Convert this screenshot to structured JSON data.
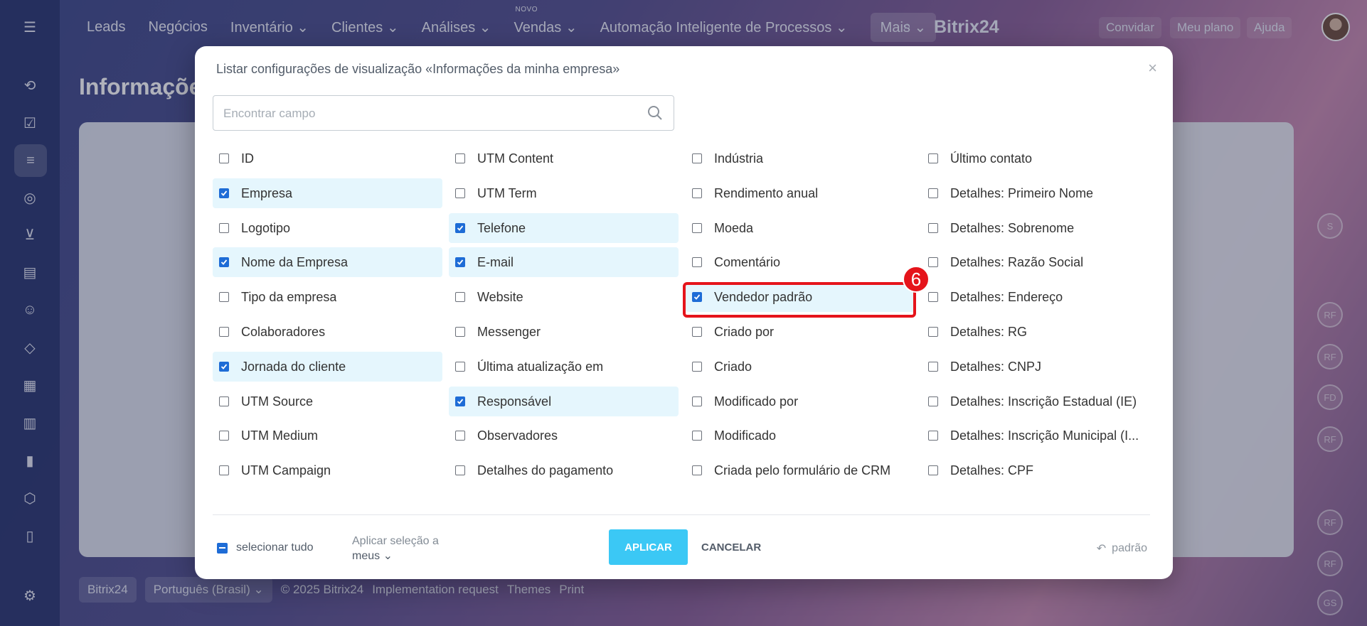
{
  "topbar": {
    "nav": [
      "Leads",
      "Negócios",
      "Inventário ⌄",
      "Clientes ⌄",
      "Análises ⌄",
      "Vendas ⌄",
      "Automação Inteligente de Processos ⌄",
      "Mais ⌄"
    ],
    "new_badge": "NOVO",
    "brand": "Bitrix24",
    "invite": "Convidar",
    "plan": "Meu plano",
    "help": "Ajuda"
  },
  "background": {
    "page_title": "Informações",
    "footer": [
      "Bitrix24",
      "Português (Brasil) ⌄",
      "© 2025 Bitrix24",
      "Implementation request",
      "Themes",
      "Print"
    ],
    "right_avatars": [
      "S",
      "RF",
      "RF",
      "FD",
      "RF",
      "RF",
      "RF",
      "GS"
    ]
  },
  "modal": {
    "title": "Listar configurações de visualização «Informações da minha empresa»",
    "search_placeholder": "Encontrar campo",
    "step_number": "6",
    "columns": [
      [
        {
          "label": "ID",
          "checked": false
        },
        {
          "label": "Empresa",
          "checked": true
        },
        {
          "label": "Logotipo",
          "checked": false
        },
        {
          "label": "Nome da Empresa",
          "checked": true
        },
        {
          "label": "Tipo da empresa",
          "checked": false
        },
        {
          "label": "Colaboradores",
          "checked": false
        },
        {
          "label": "Jornada do cliente",
          "checked": true
        },
        {
          "label": "UTM Source",
          "checked": false
        },
        {
          "label": "UTM Medium",
          "checked": false
        },
        {
          "label": "UTM Campaign",
          "checked": false
        }
      ],
      [
        {
          "label": "UTM Content",
          "checked": false
        },
        {
          "label": "UTM Term",
          "checked": false
        },
        {
          "label": "Telefone",
          "checked": true
        },
        {
          "label": "E-mail",
          "checked": true
        },
        {
          "label": "Website",
          "checked": false
        },
        {
          "label": "Messenger",
          "checked": false
        },
        {
          "label": "Última atualização em",
          "checked": false
        },
        {
          "label": "Responsável",
          "checked": true
        },
        {
          "label": "Observadores",
          "checked": false
        },
        {
          "label": "Detalhes do pagamento",
          "checked": false
        }
      ],
      [
        {
          "label": "Indústria",
          "checked": false
        },
        {
          "label": "Rendimento anual",
          "checked": false
        },
        {
          "label": "Moeda",
          "checked": false
        },
        {
          "label": "Comentário",
          "checked": false
        },
        {
          "label": "Vendedor padrão",
          "checked": true
        },
        {
          "label": "Criado por",
          "checked": false
        },
        {
          "label": "Criado",
          "checked": false
        },
        {
          "label": "Modificado por",
          "checked": false
        },
        {
          "label": "Modificado",
          "checked": false
        },
        {
          "label": "Criada pelo formulário de CRM",
          "checked": false
        }
      ],
      [
        {
          "label": "Último contato",
          "checked": false
        },
        {
          "label": "Detalhes: Primeiro Nome",
          "checked": false
        },
        {
          "label": "Detalhes: Sobrenome",
          "checked": false
        },
        {
          "label": "Detalhes: Razão Social",
          "checked": false
        },
        {
          "label": "Detalhes: Endereço",
          "checked": false
        },
        {
          "label": "Detalhes: RG",
          "checked": false
        },
        {
          "label": "Detalhes: CNPJ",
          "checked": false
        },
        {
          "label": "Detalhes: Inscrição Estadual (IE)",
          "checked": false
        },
        {
          "label": "Detalhes: Inscrição Municipal (I...",
          "checked": false
        },
        {
          "label": "Detalhes: CPF",
          "checked": false
        }
      ]
    ],
    "footer": {
      "select_all": "selecionar tudo",
      "apply_to_line1": "Aplicar seleção a",
      "apply_to_line2": "meus ⌄",
      "apply": "APLICAR",
      "cancel": "CANCELAR",
      "reset": "padrão"
    }
  }
}
